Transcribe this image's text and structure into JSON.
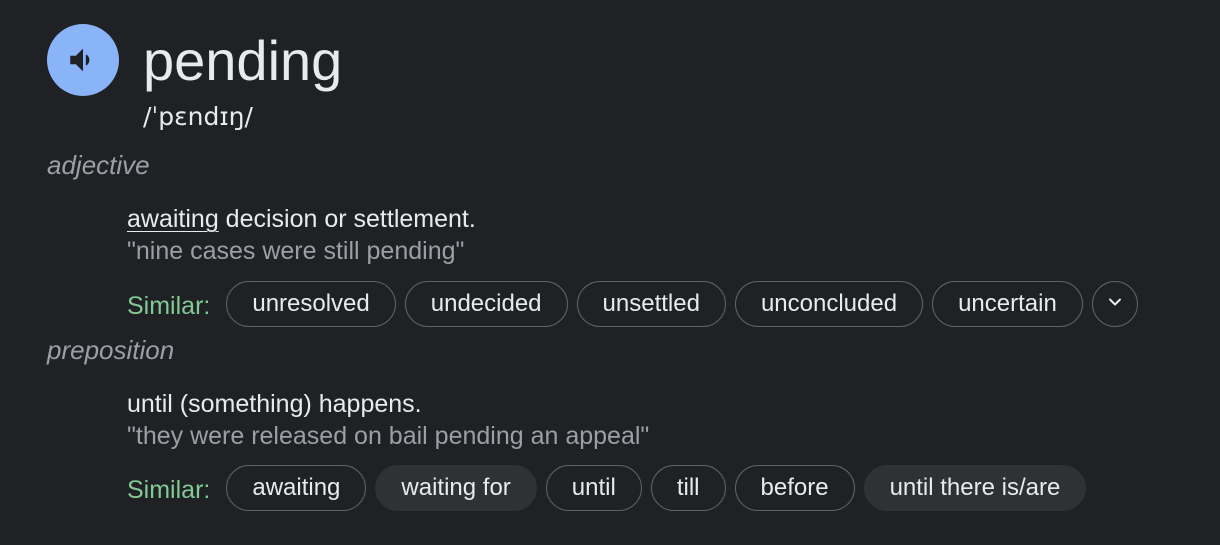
{
  "entry": {
    "word": "pending",
    "phonetic": "/ˈpɛndɪŋ/",
    "audio_icon": "speaker-icon"
  },
  "senses": [
    {
      "part_of_speech": "adjective",
      "definition_link": "awaiting",
      "definition_rest": " decision or settlement.",
      "example": "\"nine cases were still pending\"",
      "similar_label": "Similar:",
      "similar": [
        "unresolved",
        "undecided",
        "unsettled",
        "unconcluded",
        "uncertain"
      ],
      "expand_icon": "chevron-down-icon"
    },
    {
      "part_of_speech": "preposition",
      "definition": "until (something) happens.",
      "example": "\"they were released on bail pending an appeal\"",
      "similar_label": "Similar:",
      "similar": [
        "awaiting",
        "waiting for",
        "until",
        "till",
        "before",
        "until there is/are"
      ]
    }
  ],
  "colors": {
    "background": "#202124",
    "text": "#e8eaed",
    "muted": "#9aa0a6",
    "similar_label": "#81c995",
    "audio_button": "#8ab4f8",
    "chip_border": "#5f6368",
    "chip_fill": "#303134"
  }
}
